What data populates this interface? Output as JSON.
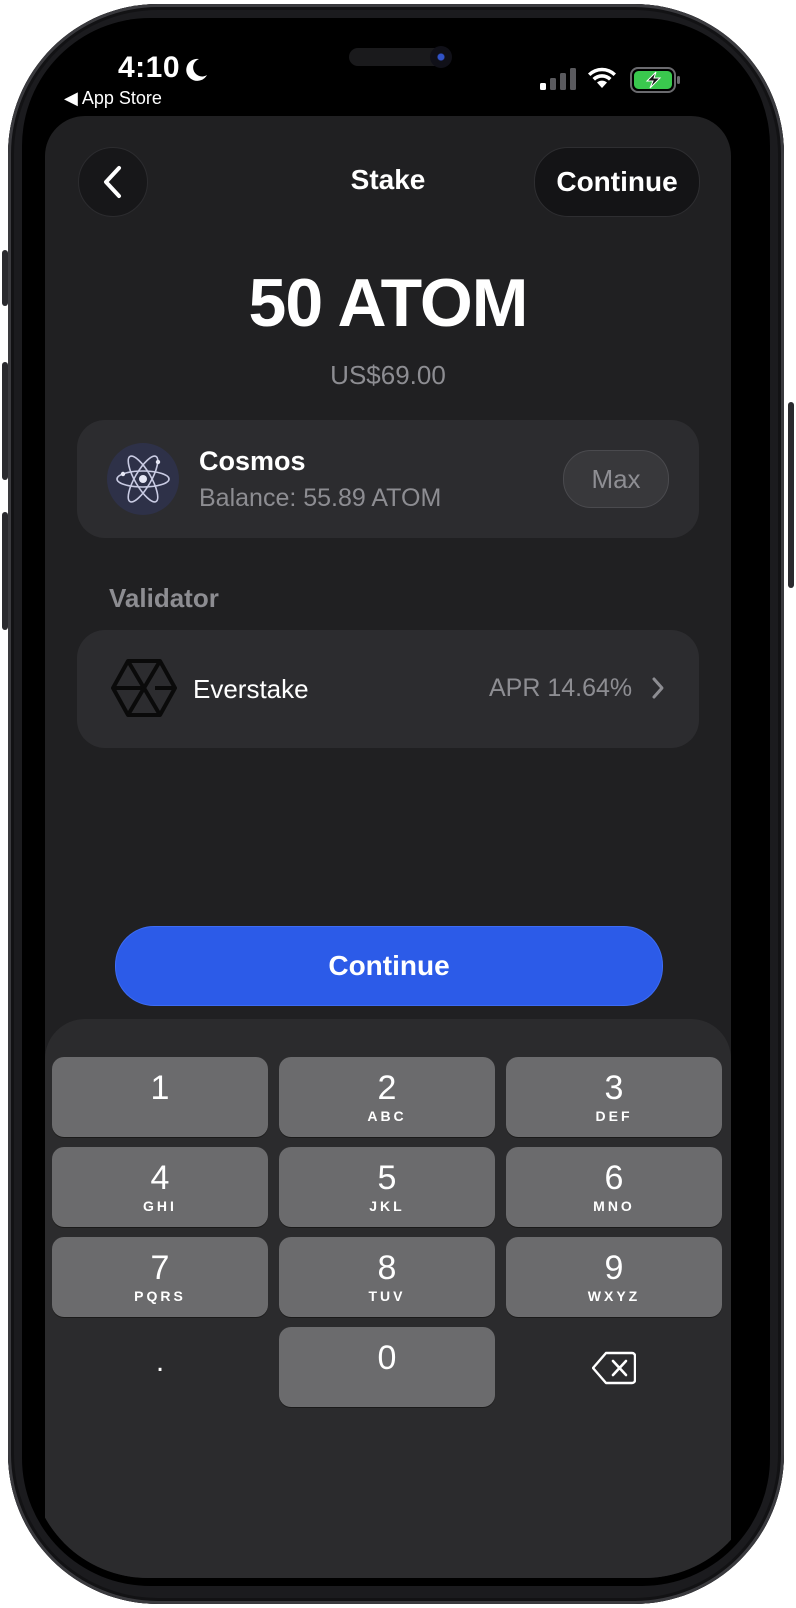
{
  "status_bar": {
    "time": "4:10",
    "back_app": "◀ App Store"
  },
  "nav": {
    "title": "Stake",
    "continue_label": "Continue"
  },
  "amount": {
    "value": "50 ATOM",
    "fiat": "US$69.00"
  },
  "asset": {
    "name": "Cosmos",
    "balance": "Balance: 55.89 ATOM",
    "max_label": "Max"
  },
  "validator": {
    "section_label": "Validator",
    "name": "Everstake",
    "apr": "APR 14.64%"
  },
  "primary_button": {
    "label": "Continue",
    "color": "#2c5be8"
  },
  "keypad": {
    "keys": [
      {
        "digit": "1",
        "letters": ""
      },
      {
        "digit": "2",
        "letters": "ABC"
      },
      {
        "digit": "3",
        "letters": "DEF"
      },
      {
        "digit": "4",
        "letters": "GHI"
      },
      {
        "digit": "5",
        "letters": "JKL"
      },
      {
        "digit": "6",
        "letters": "MNO"
      },
      {
        "digit": "7",
        "letters": "PQRS"
      },
      {
        "digit": "8",
        "letters": "TUV"
      },
      {
        "digit": "9",
        "letters": "WXYZ"
      },
      {
        "digit": "0",
        "letters": ""
      }
    ],
    "decimal": ".",
    "delete_icon": "backspace-icon"
  }
}
